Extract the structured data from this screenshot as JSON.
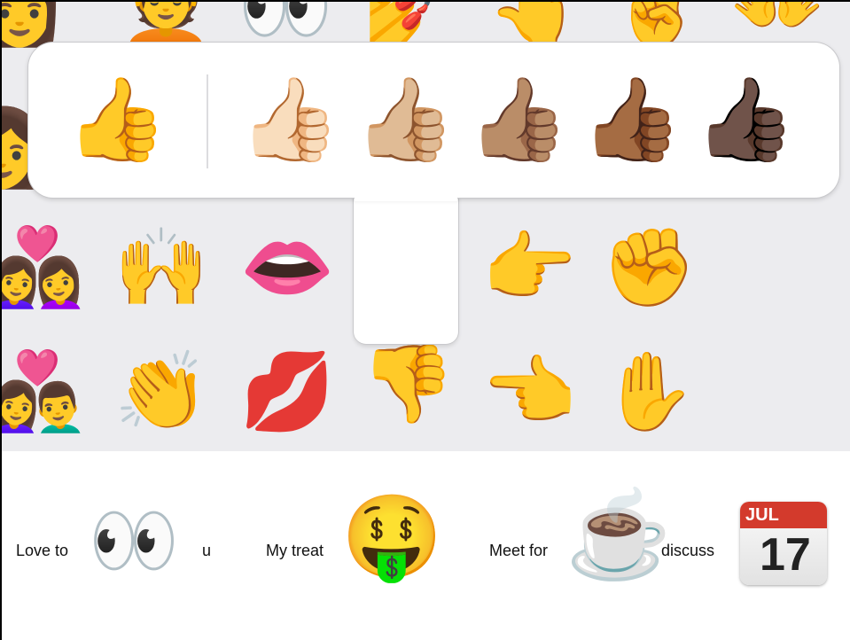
{
  "keyboard": {
    "row1": [
      "👩",
      "💆",
      "👀",
      "💅",
      "👆",
      "✌️",
      "👐"
    ],
    "row2": [
      "👩",
      "👍"
    ],
    "row3": [
      "👩‍❤️‍👩",
      "🙌",
      "👄",
      "👉",
      "✊"
    ],
    "row4": [
      "👩‍❤️‍👨",
      "👏",
      "💋",
      "👎",
      "👈",
      "✋"
    ]
  },
  "popover": {
    "default": "👍",
    "tones": [
      "👍🏻",
      "👍🏼",
      "👍🏽",
      "👍🏾",
      "👍🏿"
    ]
  },
  "messages": [
    {
      "text": "Love to",
      "emoji": "👀"
    },
    {
      "text": "u"
    },
    {
      "text": "My treat",
      "emoji": "🤑"
    },
    {
      "text": "Meet for",
      "emoji": "☕"
    },
    {
      "text": "discuss",
      "emoji": "📅"
    }
  ],
  "calendar": {
    "month": "JUL",
    "day": "17",
    "accent": "#d33a2c"
  }
}
